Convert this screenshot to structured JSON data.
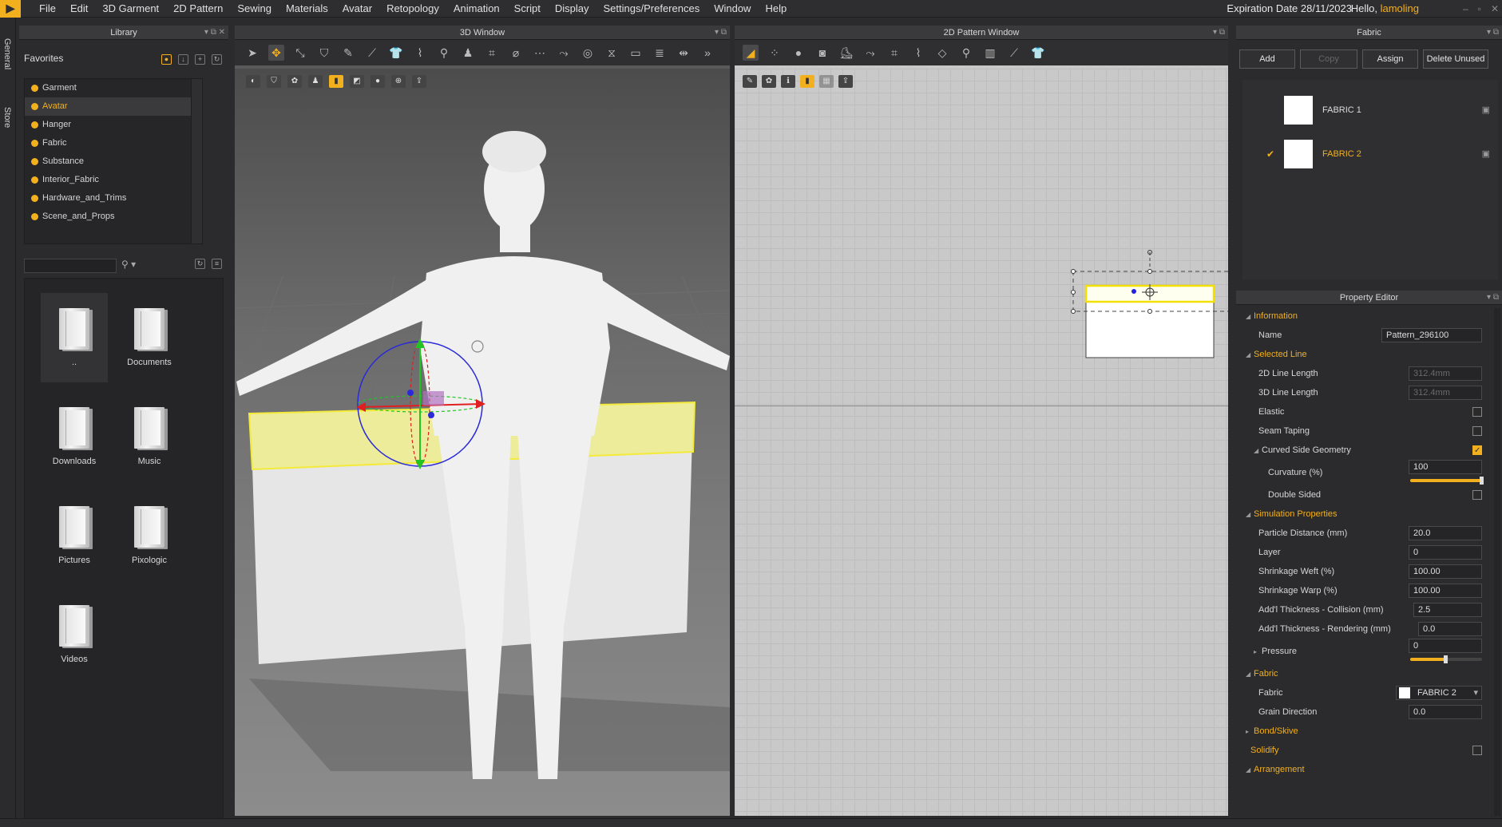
{
  "app": {
    "menus": [
      "File",
      "Edit",
      "3D Garment",
      "2D Pattern",
      "Sewing",
      "Materials",
      "Avatar",
      "Retopology",
      "Animation",
      "Script",
      "Display",
      "Settings/Preferences",
      "Window",
      "Help"
    ],
    "expiration": "Expiration Date 28/11/2023",
    "hello_prefix": "Hello,",
    "username": "lamoling",
    "side_tabs": [
      "General",
      "Store"
    ]
  },
  "library": {
    "title": "Library",
    "favorites_title": "Favorites",
    "favorites": [
      "Garment",
      "Avatar",
      "Hanger",
      "Fabric",
      "Substance",
      "Interior_Fabric",
      "Hardware_and_Trims",
      "Scene_and_Props"
    ],
    "selected_favorite": "Avatar",
    "folders": [
      "..",
      "Documents",
      "Downloads",
      "Music",
      "Pictures",
      "Pixologic",
      "Videos"
    ]
  },
  "window3d": {
    "title": "3D Window"
  },
  "window2d": {
    "title": "2D Pattern Window"
  },
  "fabric": {
    "title": "Fabric",
    "buttons": {
      "add": "Add",
      "copy": "Copy",
      "assign": "Assign",
      "delete": "Delete Unused"
    },
    "items": [
      {
        "name": "FABRIC 1",
        "selected": false
      },
      {
        "name": "FABRIC 2",
        "selected": true
      }
    ]
  },
  "property_editor": {
    "title": "Property Editor",
    "information": "Information",
    "name_label": "Name",
    "name_value": "Pattern_296100",
    "selected_line": "Selected Line",
    "line2d_label": "2D Line Length",
    "line2d_value": "312.4mm",
    "line3d_label": "3D Line Length",
    "line3d_value": "312.4mm",
    "elastic_label": "Elastic",
    "seam_taping_label": "Seam Taping",
    "curved_label": "Curved Side Geometry",
    "curvature_label": "Curvature (%)",
    "curvature_value": "100",
    "curvature_fraction": 1.0,
    "double_sided_label": "Double Sided",
    "simulation": "Simulation Properties",
    "particle_label": "Particle Distance (mm)",
    "particle_value": "20.0",
    "layer_label": "Layer",
    "layer_value": "0",
    "weft_label": "Shrinkage Weft (%)",
    "weft_value": "100.00",
    "warp_label": "Shrinkage Warp (%)",
    "warp_value": "100.00",
    "thick_col_label": "Add'l Thickness - Collision (mm)",
    "thick_col_value": "2.5",
    "thick_ren_label": "Add'l Thickness - Rendering (mm)",
    "thick_ren_value": "0.0",
    "pressure_label": "Pressure",
    "pressure_value": "0",
    "pressure_fraction": 0.5,
    "fabric_section": "Fabric",
    "fabric_label": "Fabric",
    "fabric_value": "FABRIC 2",
    "grain_label": "Grain Direction",
    "grain_value": "0.0",
    "bond_skive": "Bond/Skive",
    "solidify": "Solidify",
    "arrangement": "Arrangement"
  },
  "colors": {
    "accent": "#f2b01e",
    "panel": "#2b2b2d",
    "viewport2d": "#c9c9c9"
  }
}
